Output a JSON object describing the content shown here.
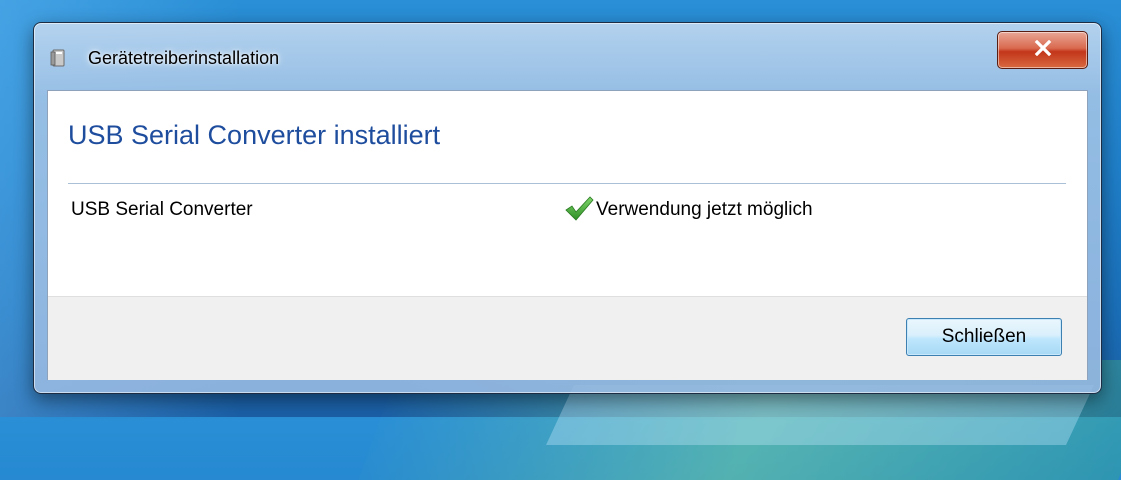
{
  "window": {
    "title": "Gerätetreiberinstallation",
    "close_symbol": "X"
  },
  "content": {
    "heading": "USB Serial Converter installiert",
    "device": {
      "name": "USB Serial Converter",
      "status": "Verwendung jetzt möglich",
      "status_icon": "checkmark-icon"
    }
  },
  "footer": {
    "close_label": "Schließen"
  },
  "colors": {
    "heading": "#1e4d9e",
    "checkmark": "#3aa82e",
    "close_button": "#c3361a"
  }
}
